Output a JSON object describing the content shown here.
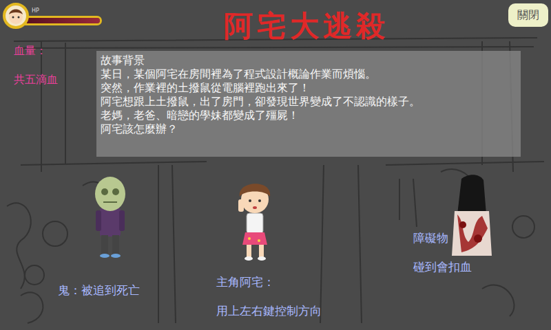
{
  "hud": {
    "hp_label": "HP",
    "hp_level": 1
  },
  "title": "阿宅大逃殺",
  "close_button": "關閉",
  "hp_info": {
    "label": "血量：",
    "value": "共五滴血"
  },
  "story": {
    "heading": "故事背景",
    "lines": [
      "某日，某個阿宅在房間裡為了程式設計概論作業而煩惱。",
      "突然，作業裡的土撥鼠從電腦裡跑出來了！",
      "阿宅想跟上土撥鼠，出了房門，卻發現世界變成了不認識的樣子。",
      "老媽，老爸、暗戀的學妹都變成了殭屍！",
      "阿宅該怎麼辦？"
    ]
  },
  "legend": {
    "ghost": "鬼：被追到死亡",
    "hero_title": "主角阿宅：",
    "hero_desc": "用上左右鍵控制方向",
    "obstacle_title": "障礙物",
    "obstacle_desc": "碰到會扣血"
  }
}
